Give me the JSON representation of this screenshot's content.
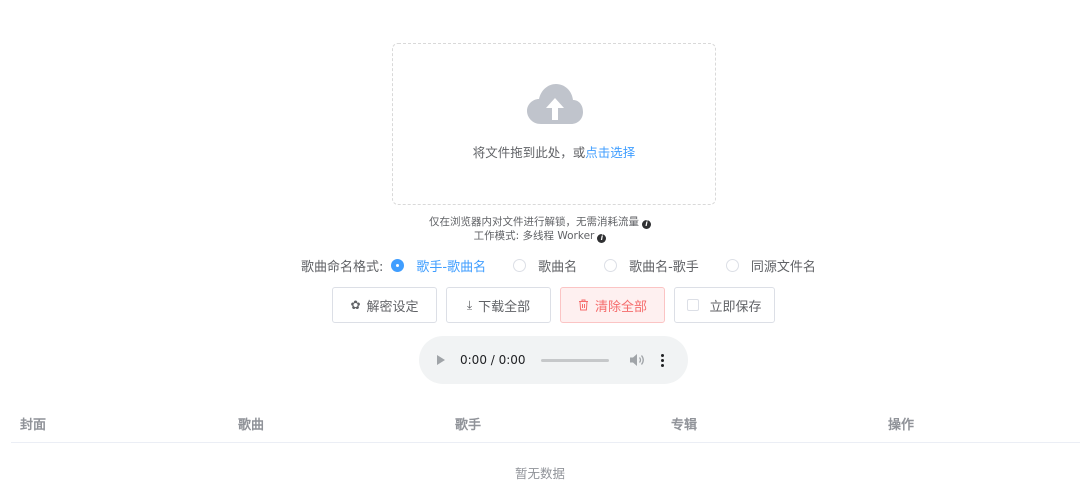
{
  "upload": {
    "text": "将文件拖到此处，或",
    "link": "点击选择"
  },
  "tips": {
    "line1": "仅在浏览器内对文件进行解锁，无需消耗流量",
    "line2": "工作模式: 多线程 Worker",
    "info_glyph": "i"
  },
  "naming": {
    "label": "歌曲命名格式:",
    "options": [
      {
        "label": "歌手-歌曲名",
        "checked": true
      },
      {
        "label": "歌曲名",
        "checked": false
      },
      {
        "label": "歌曲名-歌手",
        "checked": false
      },
      {
        "label": "同源文件名",
        "checked": false
      }
    ]
  },
  "toolbar": {
    "settings_label": "解密设定",
    "download_label": "下载全部",
    "clear_label": "清除全部",
    "save_label": "立即保存",
    "settings_icon": "✿",
    "download_icon": "⤓",
    "clear_icon": "🗑"
  },
  "audio": {
    "time": "0:00 / 0:00"
  },
  "table": {
    "columns": [
      "封面",
      "歌曲",
      "歌手",
      "专辑",
      "操作"
    ],
    "empty_text": "暂无数据"
  },
  "colors": {
    "primary": "#409eff",
    "danger": "#f56c6c",
    "border": "#dcdfe6"
  }
}
